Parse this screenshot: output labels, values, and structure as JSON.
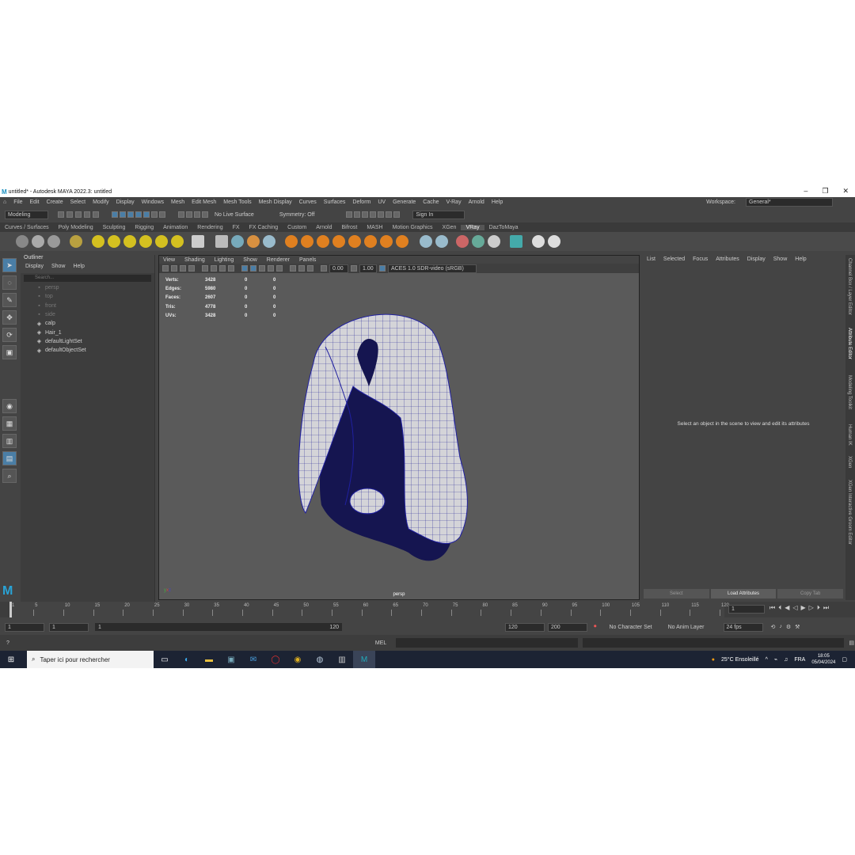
{
  "window": {
    "title": "untitled* - Autodesk MAYA 2022.3: untitled"
  },
  "menubar": [
    "File",
    "Edit",
    "Create",
    "Select",
    "Modify",
    "Display",
    "Windows",
    "Mesh",
    "Edit Mesh",
    "Mesh Tools",
    "Mesh Display",
    "Curves",
    "Surfaces",
    "Deform",
    "UV",
    "Generate",
    "Cache",
    "V-Ray",
    "Arnold",
    "Help"
  ],
  "workspace": {
    "label": "Workspace:",
    "value": "General*"
  },
  "statusline": {
    "mode": "Modeling",
    "live_surface": "No Live Surface",
    "symmetry": "Symmetry: Off",
    "sign_in": "Sign In"
  },
  "shelf_tabs": [
    "Curves / Surfaces",
    "Poly Modeling",
    "Sculpting",
    "Rigging",
    "Animation",
    "Rendering",
    "FX",
    "FX Caching",
    "Custom",
    "Arnold",
    "Bifrost",
    "MASH",
    "Motion Graphics",
    "XGen",
    "VRay",
    "DazToMaya"
  ],
  "shelf_active": "VRay",
  "outliner": {
    "title": "Outliner",
    "menu": [
      "Display",
      "Show",
      "Help"
    ],
    "search_placeholder": "Search...",
    "items": [
      {
        "label": "persp",
        "dim": true
      },
      {
        "label": "top",
        "dim": true
      },
      {
        "label": "front",
        "dim": true
      },
      {
        "label": "side",
        "dim": true
      },
      {
        "label": "calp",
        "dim": false
      },
      {
        "label": "Hair_1",
        "dim": false
      },
      {
        "label": "defaultLightSet",
        "dim": false
      },
      {
        "label": "defaultObjectSet",
        "dim": false
      }
    ]
  },
  "viewport": {
    "menu": [
      "View",
      "Shading",
      "Lighting",
      "Show",
      "Renderer",
      "Panels"
    ],
    "exposure": "0.00",
    "gamma": "1.00",
    "color_space": "ACES 1.0 SDR-video (sRGB)",
    "camera": "persp",
    "hud": [
      {
        "label": "Verts:",
        "v": "3428",
        "a": "0",
        "b": "0"
      },
      {
        "label": "Edges:",
        "v": "5980",
        "a": "0",
        "b": "0"
      },
      {
        "label": "Faces:",
        "v": "2607",
        "a": "0",
        "b": "0"
      },
      {
        "label": "Tris:",
        "v": "4778",
        "a": "0",
        "b": "0"
      },
      {
        "label": "UVs:",
        "v": "3428",
        "a": "0",
        "b": "0"
      }
    ]
  },
  "attribute_editor": {
    "menu": [
      "List",
      "Selected",
      "Focus",
      "Attributes",
      "Display",
      "Show",
      "Help"
    ],
    "message": "Select an object in the scene to view and edit its attributes",
    "buttons": [
      "Select",
      "Load Attributes",
      "Copy Tab"
    ]
  },
  "side_tabs": [
    "Channel Box / Layer Editor",
    "Attribute Editor",
    "Modeling Toolkit",
    "Human IK",
    "XGen",
    "XGen Interactive Groom Editor"
  ],
  "timeline": {
    "ticks": [
      "1",
      "5",
      "10",
      "15",
      "20",
      "25",
      "30",
      "35",
      "40",
      "45",
      "50",
      "55",
      "60",
      "65",
      "70",
      "75",
      "80",
      "85",
      "90",
      "95",
      "100",
      "105",
      "110",
      "115",
      "120"
    ],
    "current": "1"
  },
  "range": {
    "start": "1",
    "playback_start": "1",
    "slider_start": "1",
    "slider_end": "120",
    "playback_end": "120",
    "end": "200",
    "character_set": "No Character Set",
    "anim_layer": "No Anim Layer",
    "fps": "24 fps"
  },
  "command": {
    "lang": "MEL"
  },
  "taskbar": {
    "search": "Taper ici pour rechercher",
    "weather": "25°C  Ensoleillé",
    "lang": "FRA",
    "time": "18:05",
    "date": "05/04/2024"
  }
}
